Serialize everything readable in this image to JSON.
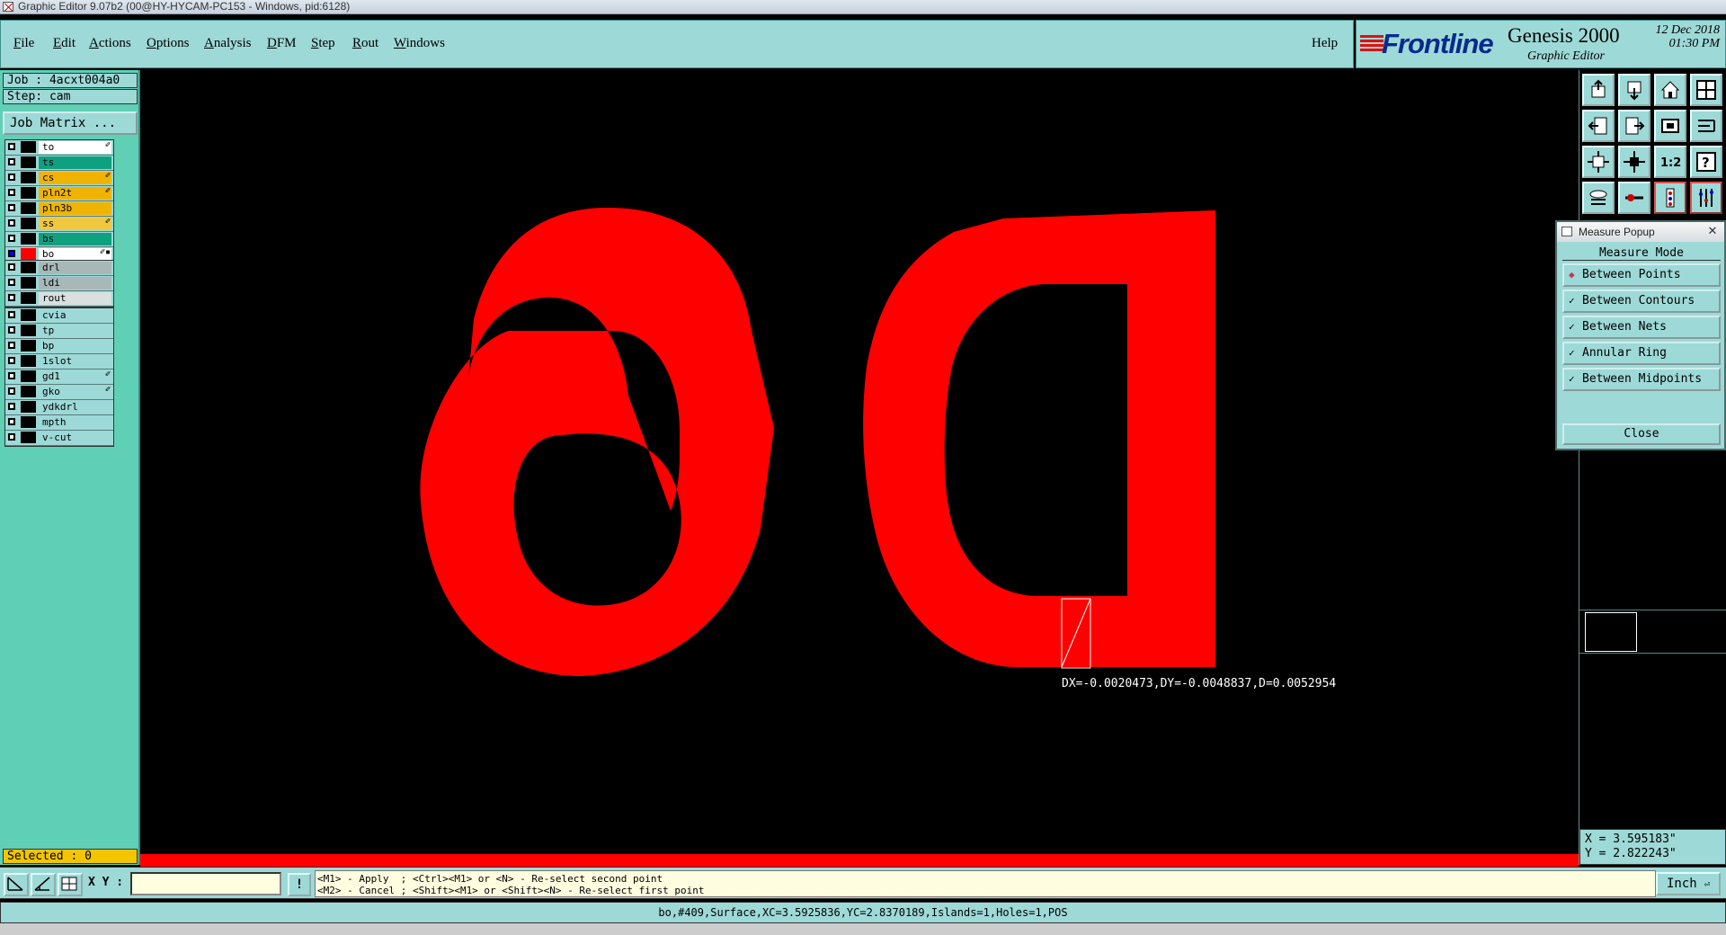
{
  "window": {
    "title": "Graphic Editor 9.07b2 (00@HY-HYCAM-PC153 - Windows, pid:6128)"
  },
  "menu": {
    "items": [
      {
        "ul": "F",
        "rest": "ile"
      },
      {
        "ul": "E",
        "rest": "dit"
      },
      {
        "ul": "A",
        "rest": "ctions"
      },
      {
        "ul": "O",
        "rest": "ptions"
      },
      {
        "ul": "A",
        "rest": "nalysis"
      },
      {
        "ul": "D",
        "rest": "FM"
      },
      {
        "ul": "S",
        "rest": "tep"
      },
      {
        "ul": "R",
        "rest": "out"
      },
      {
        "ul": "W",
        "rest": "indows"
      }
    ],
    "help": "Help"
  },
  "branding": {
    "company": "Frontline",
    "product": "Genesis 2000",
    "subtitle": "Graphic Editor",
    "date": "12 Dec 2018",
    "time": "01:30 PM"
  },
  "job": {
    "job_label": "Job : 4acxt004a0",
    "step_label": "Step: cam",
    "matrix_button": "Job Matrix ..."
  },
  "layers": {
    "group1": [
      {
        "name": "to",
        "bg": "#ffffff",
        "mark": "✐",
        "on": false
      },
      {
        "name": "ts",
        "bg": "#0fa080",
        "mark": "",
        "on": false
      },
      {
        "name": "cs",
        "bg": "#f0b400",
        "mark": "✐",
        "on": false
      },
      {
        "name": "pln2t",
        "bg": "#f0b400",
        "mark": "✐",
        "on": false
      },
      {
        "name": "pln3b",
        "bg": "#f0b400",
        "mark": "",
        "on": false
      },
      {
        "name": "ss",
        "bg": "#f0c840",
        "mark": "✐",
        "on": false
      },
      {
        "name": "bs",
        "bg": "#0fa080",
        "mark": "",
        "on": false
      },
      {
        "name": "bo",
        "bg": "#ffffff",
        "mark": "✐▪",
        "on": true,
        "color": "#ff0000"
      }
    ],
    "group2": [
      {
        "name": "drl",
        "bg": "#a8b8b8",
        "mark": "",
        "on": false
      },
      {
        "name": "ldi",
        "bg": "#a8b8b8",
        "mark": "",
        "on": false
      },
      {
        "name": "rout",
        "bg": "#d8e0e0",
        "mark": "",
        "on": false
      }
    ],
    "group3": [
      {
        "name": "cvia",
        "bg": "#9dd9d7",
        "mark": "",
        "on": false
      },
      {
        "name": "tp",
        "bg": "#9dd9d7",
        "mark": "",
        "on": false
      },
      {
        "name": "bp",
        "bg": "#9dd9d7",
        "mark": "",
        "on": false
      },
      {
        "name": "1slot",
        "bg": "#9dd9d7",
        "mark": "",
        "on": false
      },
      {
        "name": "gd1",
        "bg": "#9dd9d7",
        "mark": "✐",
        "on": false
      },
      {
        "name": "gko",
        "bg": "#9dd9d7",
        "mark": "✐",
        "on": false
      },
      {
        "name": "ydkdrl",
        "bg": "#9dd9d7",
        "mark": "",
        "on": false
      },
      {
        "name": "mpth",
        "bg": "#9dd9d7",
        "mark": "",
        "on": false
      },
      {
        "name": "v-cut",
        "bg": "#9dd9d7",
        "mark": "",
        "on": false
      }
    ],
    "selected_label": "Selected : 0"
  },
  "canvas": {
    "shape_color": "#ff0000",
    "measure_text": "DX=-0.0020473,DY=-0.0048837,D=0.0052954"
  },
  "toolbar": {
    "buttons": [
      "layer-up-icon",
      "layer-down-icon",
      "home-icon",
      "split-view-icon",
      "pan-left-icon",
      "pan-right-icon",
      "zoom-fit-icon",
      "zoom-area-icon",
      "zoom-fit-all-icon",
      "zoom-center-icon",
      "scale-1-2-icon",
      "help-icon",
      "snap-icon",
      "measure-icon",
      "profile-icon",
      "lights-icon"
    ],
    "scale_label": "1:2"
  },
  "measure_popup": {
    "title": "Measure Popup",
    "mode_label": "Measure Mode",
    "options": [
      "Between Points",
      "Between Contours",
      "Between Nets",
      "Annular Ring",
      "Between Midpoints"
    ],
    "selected_index": 0,
    "close_label": "Close"
  },
  "coords": {
    "x": "X = 3.595183\"",
    "y": "Y = 2.822243\""
  },
  "bottom": {
    "xy_label": "X Y :",
    "xy_value": "",
    "info_label": "!",
    "prompt_line1": "<M1> - Apply  ; <Ctrl><M1> or <N> - Re-select second point",
    "prompt_line2": "<M2> - Cancel ; <Shift><M1> or <Shift><N> - Re-select first point",
    "units": "Inch",
    "status": "bo,#409,Surface,XC=3.5925836,YC=2.8370189,Islands=1,Holes=1,POS"
  }
}
